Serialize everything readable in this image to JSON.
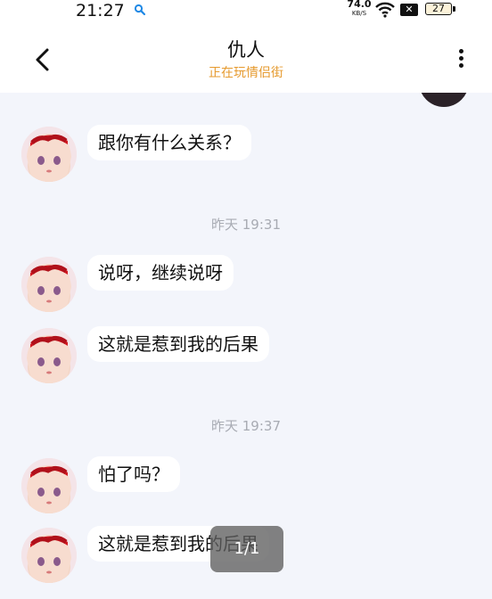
{
  "status_bar": {
    "time": "21:27",
    "net_speed_value": "74.0",
    "net_speed_unit": "KB/S",
    "battery": "27"
  },
  "header": {
    "title": "仇人",
    "subtitle": "正在玩情侣街"
  },
  "messages": [
    {
      "text": "跟你有什么关系？"
    },
    {
      "text": "说呀，继续说呀"
    },
    {
      "text": "这就是惹到我的后果"
    },
    {
      "text": "怕了吗？"
    },
    {
      "text": "这就是惹到我的后果"
    }
  ],
  "timestamps": [
    "昨天 19:31",
    "昨天 19:37"
  ],
  "overlay": {
    "page_indicator": "1/1"
  },
  "colors": {
    "subtitle": "#e69a2e",
    "chat_background": "#f3f5fb",
    "bubble": "#ffffff",
    "timestamp": "#a8abb3"
  },
  "icons": [
    "search-icon",
    "wifi-icon",
    "no-sim-icon",
    "battery-icon",
    "back-arrow-icon",
    "more-vertical-icon"
  ]
}
